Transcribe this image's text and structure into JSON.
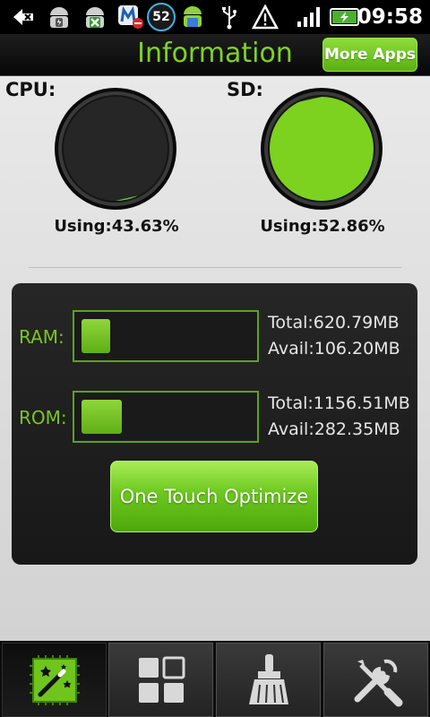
{
  "status_bar": {
    "time": "09:58",
    "notification_count": "52",
    "icons": [
      "back-arrow-icon",
      "android-charging-icon",
      "android-error-icon",
      "maxthon-blocked-icon",
      "badge-52-icon",
      "android-download-icon",
      "usb-icon",
      "warning-icon",
      "signal-icon",
      "battery-icon"
    ]
  },
  "header": {
    "title": "Information",
    "more_apps_label": "More Apps"
  },
  "gauges": {
    "cpu": {
      "label": "CPU:",
      "using_text": "Using:43.63%",
      "percent": 43.63
    },
    "sd": {
      "label": "SD:",
      "using_text": "Using:52.86%",
      "percent": 52.86
    }
  },
  "memory": {
    "ram": {
      "label": "RAM:",
      "total": "Total:620.79MB",
      "avail": "Avail:106.20MB",
      "used_fraction": 0.17
    },
    "rom": {
      "label": "ROM:",
      "total": "Total:1156.51MB",
      "avail": "Avail:282.35MB",
      "used_fraction": 0.24
    }
  },
  "optimize_button": {
    "label": "One Touch Optimize"
  },
  "tabs": [
    {
      "name": "info",
      "icon": "magic-wand-chip-icon",
      "active": true
    },
    {
      "name": "apps",
      "icon": "grid-squares-icon",
      "active": false
    },
    {
      "name": "cleaner",
      "icon": "broom-icon",
      "active": false
    },
    {
      "name": "tools",
      "icon": "wrench-screwdriver-icon",
      "active": false
    }
  ],
  "colors": {
    "accent_green": "#7ed321",
    "gauge_fill": "#7cd21f",
    "panel_bg": "#1f1f1f"
  }
}
